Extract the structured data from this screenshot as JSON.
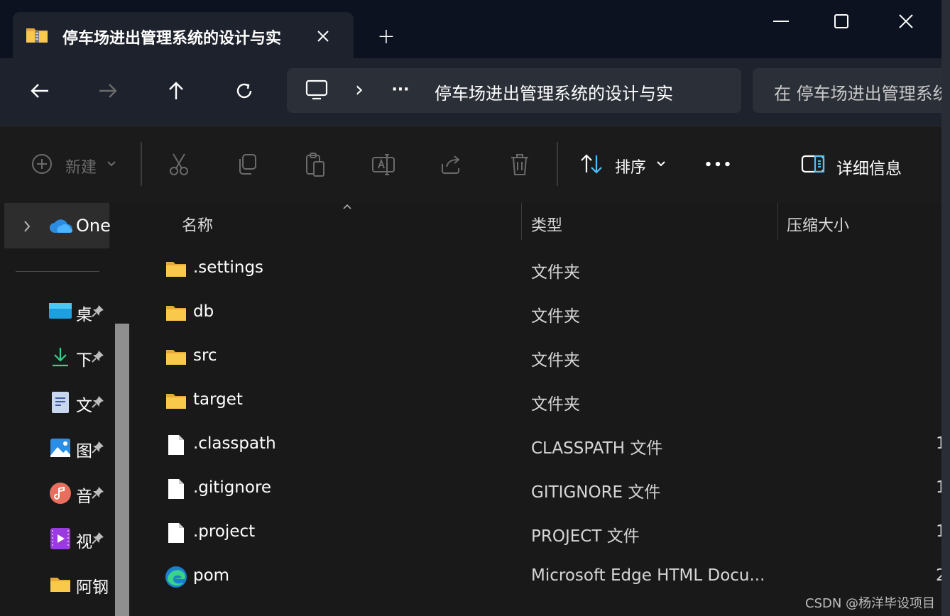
{
  "window": {
    "tab_title": "停车场进出管理系统的设计与实",
    "new_tab_symbol": "+",
    "minimize_symbol": "—",
    "close_symbol": "✕"
  },
  "navigation": {
    "breadcrumb_more": "···",
    "breadcrumb_chevron": "›",
    "breadcrumb_folder": "停车场进出管理系统的设计与实",
    "search_placeholder": "在 停车场进出管理系统的设计与实"
  },
  "toolbar": {
    "new_label": "新建",
    "sort_label": "排序",
    "more_label": "•••",
    "details_label": "详细信息"
  },
  "sidebar": {
    "onedrive_label": "One",
    "quick_access": [
      {
        "label": "桌",
        "icon": "desktop-icon"
      },
      {
        "label": "下",
        "icon": "download-icon"
      },
      {
        "label": "文",
        "icon": "document-icon"
      },
      {
        "label": "图",
        "icon": "picture-icon"
      },
      {
        "label": "音",
        "icon": "music-icon"
      },
      {
        "label": "视",
        "icon": "video-icon"
      },
      {
        "label": "阿钢",
        "icon": "folder-icon"
      }
    ]
  },
  "columns": {
    "name": "名称",
    "type": "类型",
    "size": "压缩大小"
  },
  "files": [
    {
      "name": ".settings",
      "type": "文件夹",
      "kind": "folder",
      "size": ""
    },
    {
      "name": "db",
      "type": "文件夹",
      "kind": "folder",
      "size": ""
    },
    {
      "name": "src",
      "type": "文件夹",
      "kind": "folder",
      "size": ""
    },
    {
      "name": "target",
      "type": "文件夹",
      "kind": "folder",
      "size": ""
    },
    {
      "name": ".classpath",
      "type": "CLASSPATH 文件",
      "kind": "file",
      "size": "1"
    },
    {
      "name": ".gitignore",
      "type": "GITIGNORE 文件",
      "kind": "file",
      "size": "1"
    },
    {
      "name": ".project",
      "type": "PROJECT 文件",
      "kind": "file",
      "size": "1"
    },
    {
      "name": "pom",
      "type": "Microsoft Edge HTML Docu...",
      "kind": "edge",
      "size": "2"
    }
  ],
  "watermark": "CSDN @杨洋毕设项目",
  "colors": {
    "titlebar": "#0d1220",
    "chrome": "#1e222c",
    "background": "#191919",
    "folder": "#f8c94a",
    "accent": "#4cc2ff"
  }
}
